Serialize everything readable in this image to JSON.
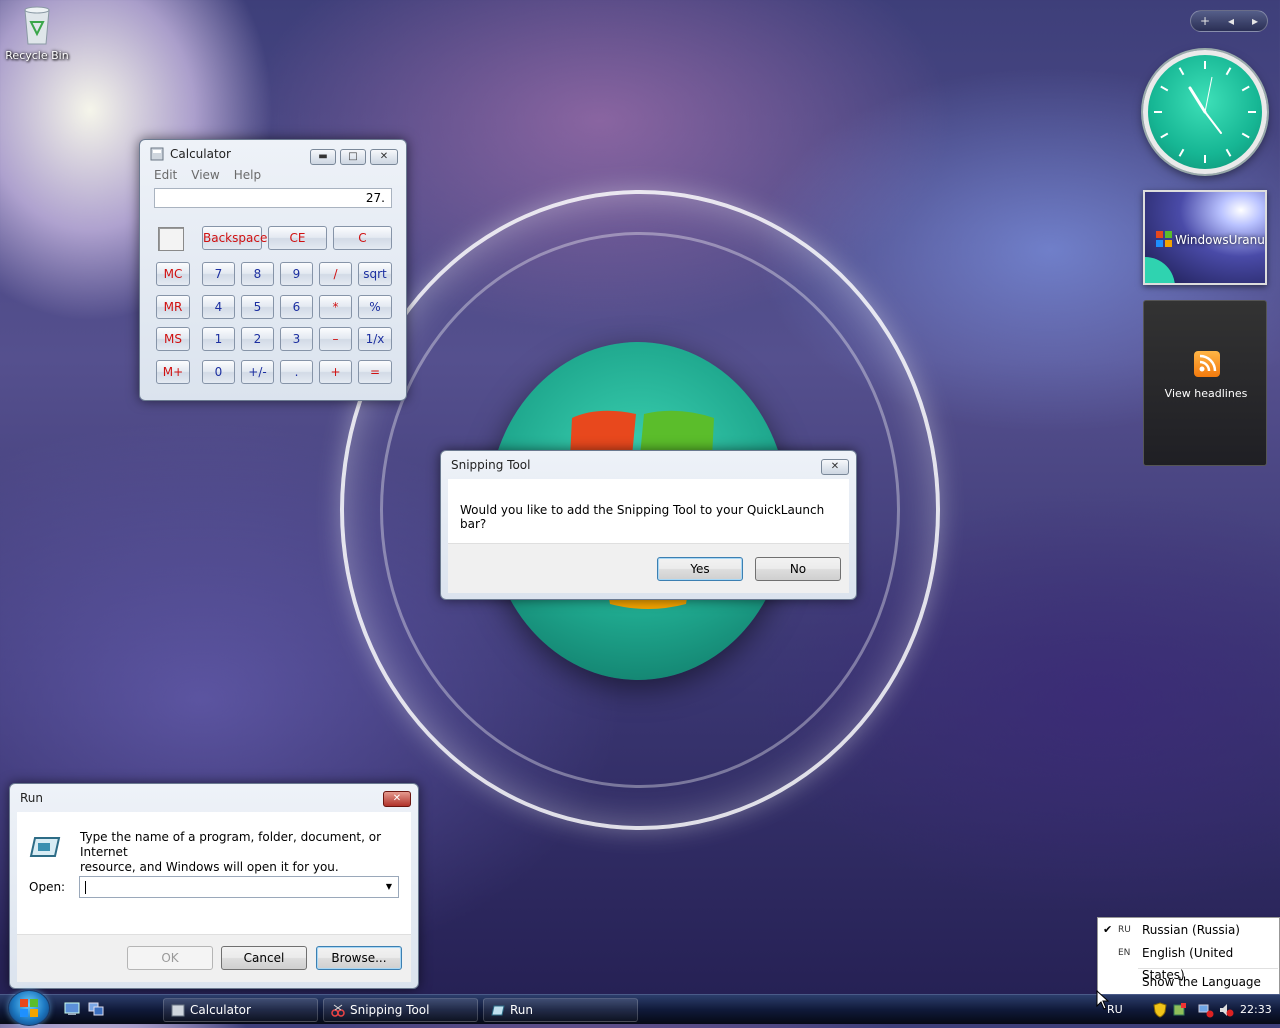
{
  "desktop": {
    "recycle_bin_label": "Recycle Bin"
  },
  "calculator": {
    "title": "Calculator",
    "menu": [
      "Edit",
      "View",
      "Help"
    ],
    "display_value": "27.",
    "buttons": {
      "backspace": "Backspace",
      "ce": "CE",
      "c": "C",
      "mc": "MC",
      "mr": "MR",
      "ms": "MS",
      "mplus": "M+",
      "n7": "7",
      "n8": "8",
      "n9": "9",
      "div": "/",
      "sqrt": "sqrt",
      "n4": "4",
      "n5": "5",
      "n6": "6",
      "mul": "*",
      "pct": "%",
      "n1": "1",
      "n2": "2",
      "n3": "3",
      "sub": "–",
      "inv": "1/x",
      "n0": "0",
      "sign": "+/-",
      "dot": ".",
      "add": "+",
      "eq": "="
    }
  },
  "snipping_dialog": {
    "title": "Snipping Tool",
    "message": "Would you like to add the Snipping Tool to your QuickLaunch bar?",
    "yes": "Yes",
    "no": "No"
  },
  "run_dialog": {
    "title": "Run",
    "description_line1": "Type the name of a program, folder, document, or Internet",
    "description_line2": "resource, and Windows will open it for you.",
    "open_label": "Open:",
    "open_value": "",
    "ok": "OK",
    "cancel": "Cancel",
    "browse": "Browse..."
  },
  "gadgets": {
    "toolbar": {
      "add": "+",
      "prev": "◂",
      "next": "▸"
    },
    "slideshow_text": "WindowsUranus",
    "feeds_label": "View headlines"
  },
  "language_menu": {
    "items": [
      {
        "code": "RU",
        "name": "Russian (Russia)",
        "checked": true
      },
      {
        "code": "EN",
        "name": "English (United States)",
        "checked": false
      }
    ],
    "show_bar": "Show the Language bar"
  },
  "taskbar": {
    "buttons": [
      "Calculator",
      "Snipping Tool",
      "Run"
    ],
    "language": "RU",
    "time": "22:33"
  },
  "colors": {
    "calc_digit_text": "#1c2fa0",
    "calc_func_text": "#d01010",
    "accent_teal": "#16b694"
  }
}
